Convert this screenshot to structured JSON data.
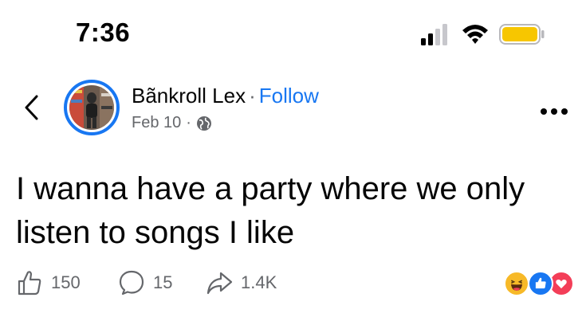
{
  "status_bar": {
    "time": "7:36",
    "signal_icon": "cellular-signal-icon",
    "wifi_icon": "wifi-icon",
    "battery_icon": "battery-icon",
    "battery_color": "#f7c600"
  },
  "header": {
    "back_icon": "back-chevron-icon",
    "author_name": "Bãnkroll Lex",
    "separator": "·",
    "follow_label": "Follow",
    "date": "Feb 10",
    "date_separator": "·",
    "audience_icon": "globe-icon",
    "more_icon": "more-options-icon"
  },
  "post": {
    "text": "I wanna have a party where we only listen to songs I like"
  },
  "actions": {
    "like_count": "150",
    "comment_count": "15",
    "share_count": "1.4K",
    "like_icon": "thumbs-up-icon",
    "comment_icon": "comment-bubble-icon",
    "share_icon": "share-arrow-icon"
  },
  "reactions": [
    "haha",
    "like",
    "love"
  ],
  "colors": {
    "accent": "#1877f2",
    "secondary_text": "#65676b",
    "haha": "#f7b928",
    "like": "#1877f2",
    "love": "#f33e58"
  }
}
